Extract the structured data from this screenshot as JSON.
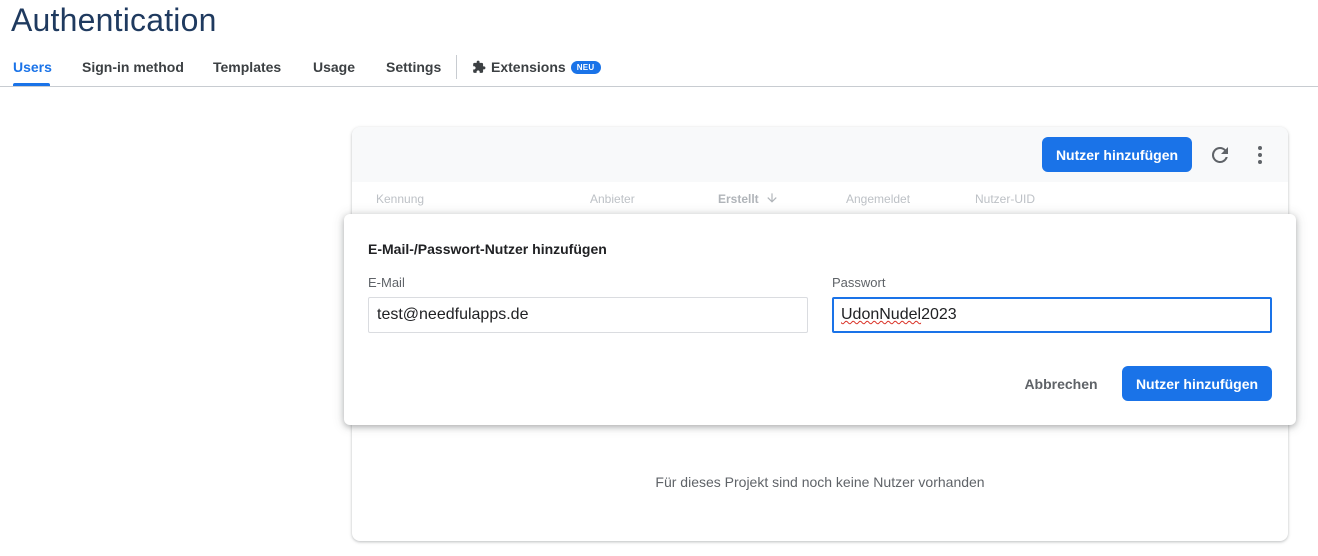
{
  "page": {
    "title": "Authentication"
  },
  "tabs": [
    {
      "label": "Users",
      "active": true
    },
    {
      "label": "Sign-in method"
    },
    {
      "label": "Templates"
    },
    {
      "label": "Usage"
    },
    {
      "label": "Settings"
    },
    {
      "label": "Extensions",
      "icon": "extensions-icon",
      "badge": "NEU"
    }
  ],
  "users_panel": {
    "add_button": "Nutzer hinzufügen",
    "refresh_icon": "refresh-icon",
    "menu_icon": "more-vert-icon",
    "columns": [
      "Kennung",
      "Anbieter",
      "Erstellt",
      "Angemeldet",
      "Nutzer-UID"
    ],
    "sort_icon": "arrow-down-icon",
    "empty_message": "Für dieses Projekt sind noch keine Nutzer vorhanden"
  },
  "dialog": {
    "title": "E-Mail-/Passwort-Nutzer hinzufügen",
    "email_label": "E-Mail",
    "email_value": "test@needfulapps.de",
    "password_label": "Passwort",
    "password_value_spellchecked": "UdonNudel",
    "password_value_rest": "2023",
    "cancel_button": "Abbrechen",
    "submit_button": "Nutzer hinzufügen"
  },
  "colors": {
    "accent": "#1a73e8",
    "title": "#1f3a5f"
  }
}
